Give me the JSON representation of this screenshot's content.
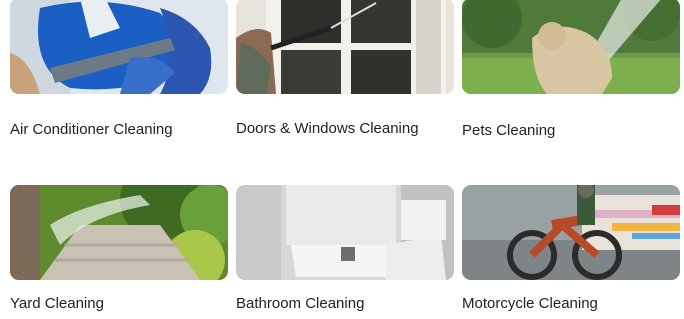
{
  "services": [
    {
      "label": "Air Conditioner Cleaning",
      "image": "ac-cleaning-photo"
    },
    {
      "label": "Doors & Windows Cleaning",
      "image": "window-washing-photo"
    },
    {
      "label": "Pets Cleaning",
      "image": "dog-shower-photo"
    },
    {
      "label": "Yard Cleaning",
      "image": "yard-pressure-wash-photo"
    },
    {
      "label": "Bathroom Cleaning",
      "image": "bathroom-photo"
    },
    {
      "label": "Motorcycle Cleaning",
      "image": "motorcycle-wash-photo"
    }
  ]
}
